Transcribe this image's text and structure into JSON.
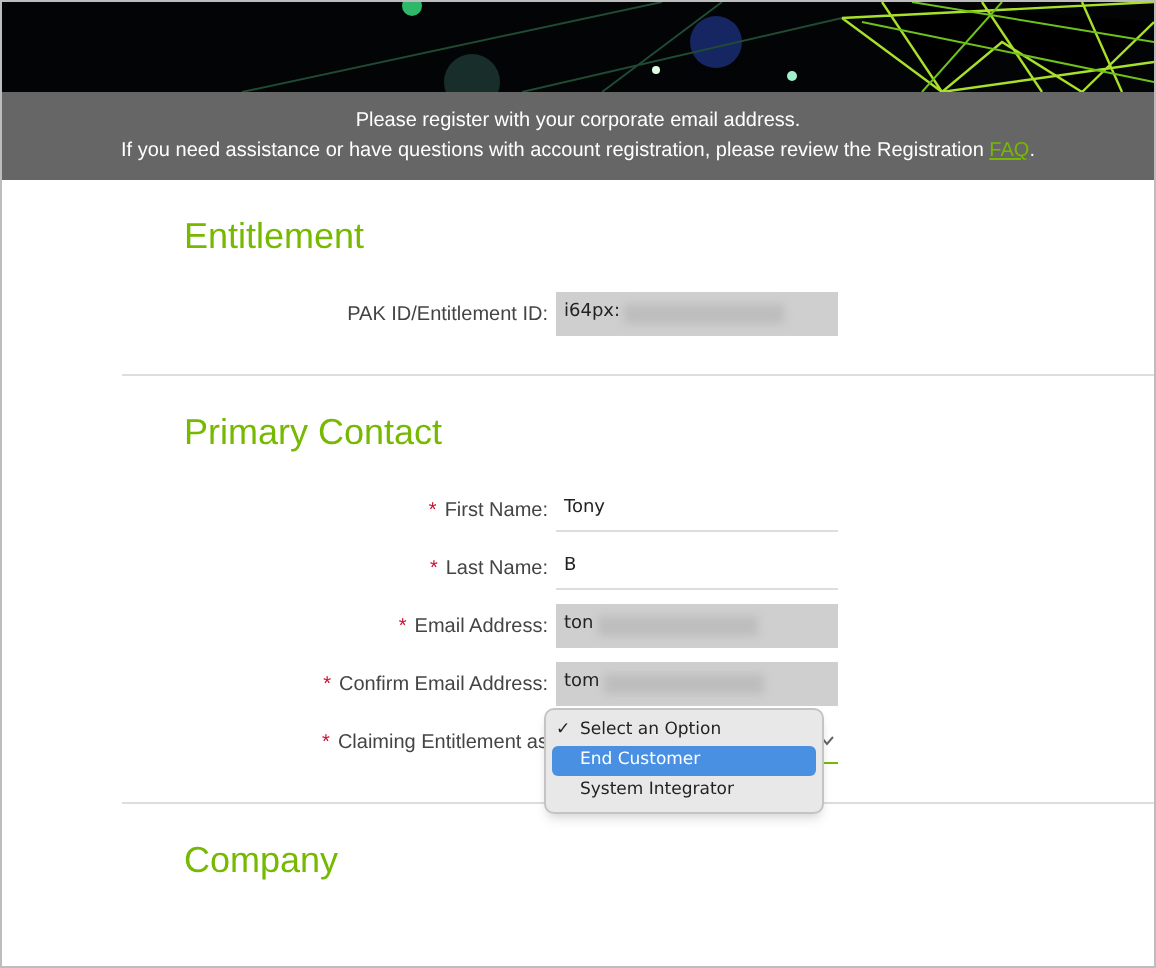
{
  "notice": {
    "lines": [
      "Please register with your corporate email address.",
      "If you need assistance or have questions with account registration, please review the Registration"
    ],
    "link": "FAQ",
    "after_link": "."
  },
  "sections": [
    {
      "title": "Entitlement",
      "fields": [
        {
          "label": "PAK ID/Entitlement ID:",
          "value": "i64px:",
          "readonly": true,
          "blurred": true
        }
      ]
    },
    {
      "title": "Primary Contact",
      "fields": [
        {
          "required_mark": "*",
          "label": "First Name:",
          "value": "Tony",
          "readonly": false,
          "blurred": false
        },
        {
          "required_mark": "*",
          "label": "Last Name:",
          "value": "B",
          "readonly": false,
          "blurred": false
        },
        {
          "required_mark": "*",
          "label": "Email Address:",
          "value": "ton",
          "readonly": true,
          "blurred": true
        },
        {
          "required_mark": "*",
          "label": "Confirm Email Address:",
          "value": "tom",
          "readonly": true,
          "blurred": true
        },
        {
          "required_mark": "*",
          "label": "Claiming Entitlement as",
          "kind": "select",
          "check_glyph": "✓",
          "options": [
            {
              "label": "Select an Option",
              "checked": true,
              "selected": false
            },
            {
              "label": "End Customer",
              "checked": false,
              "selected": true
            },
            {
              "label": "System Integrator",
              "checked": false,
              "selected": false
            }
          ]
        }
      ]
    },
    {
      "title": "Company"
    }
  ]
}
